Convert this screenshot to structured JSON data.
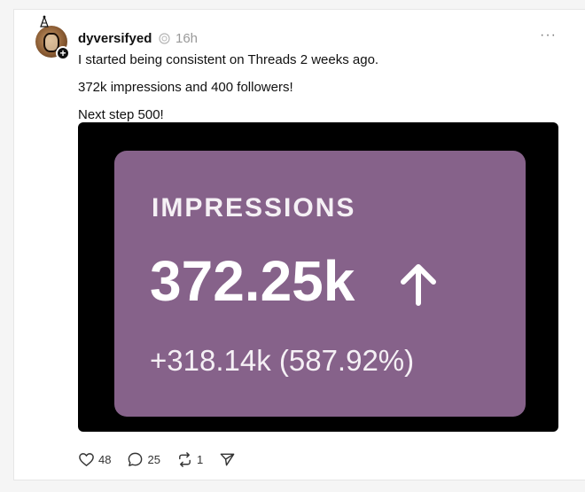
{
  "post": {
    "username": "dyversifyed",
    "time": "16h",
    "more": "···",
    "lines": [
      "I started being consistent on Threads 2 weeks ago.",
      "372k impressions and 400 followers!",
      "Next step 500!"
    ]
  },
  "image": {
    "label": "IMPRESSIONS",
    "value": "372.25k",
    "change": "+318.14k (587.92%)"
  },
  "actions": {
    "likes": "48",
    "replies": "25",
    "reposts": "1"
  },
  "icons": {
    "like": "heart-icon",
    "reply": "comment-icon",
    "repost": "repost-icon",
    "share": "send-icon",
    "verified": "badge-icon",
    "more": "more-icon"
  },
  "colors": {
    "card_purple": "#86628a",
    "media_bg": "#000000"
  }
}
